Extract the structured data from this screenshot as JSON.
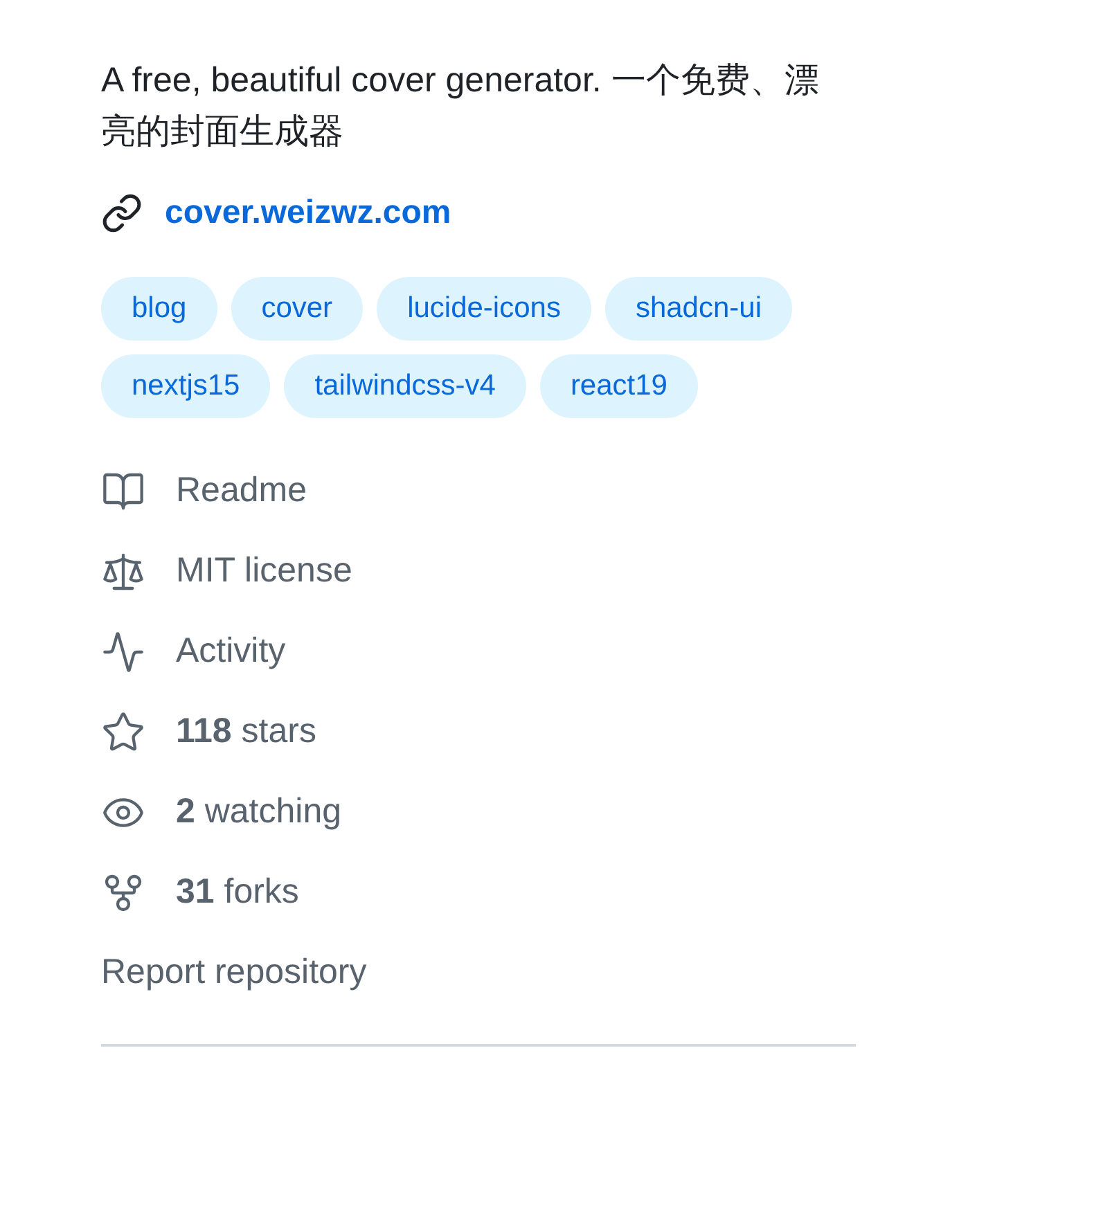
{
  "about": {
    "description": "A free, beautiful cover generator. 一个免费、漂亮的封面生成器",
    "website": "cover.weizwz.com",
    "topics": [
      "blog",
      "cover",
      "lucide-icons",
      "shadcn-ui",
      "nextjs15",
      "tailwindcss-v4",
      "react19"
    ],
    "links": [
      {
        "kind": "readme",
        "text": "Readme"
      },
      {
        "kind": "license",
        "text": "MIT license"
      },
      {
        "kind": "activity",
        "text": "Activity"
      },
      {
        "kind": "stars",
        "text": "**118** stars"
      },
      {
        "kind": "watching",
        "text": "**2** watching"
      },
      {
        "kind": "forks",
        "text": "**31** forks"
      }
    ],
    "report": "Report repository"
  }
}
